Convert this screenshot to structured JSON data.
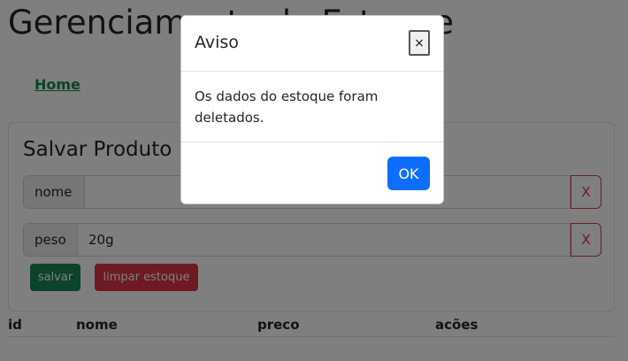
{
  "page": {
    "title": "Gerenciamento de Estoque"
  },
  "nav": {
    "home_label": "Home"
  },
  "form": {
    "title": "Salvar Produto",
    "nome": {
      "label": "nome",
      "value": "",
      "clear_label": "X"
    },
    "peso": {
      "label": "peso",
      "value": "20g",
      "clear_label": "X"
    },
    "save_label": "salvar",
    "clear_stock_label": "limpar estoque"
  },
  "table": {
    "headers": [
      "id",
      "nome",
      "preco",
      "acões"
    ]
  },
  "modal": {
    "title": "Aviso",
    "close_label": "×",
    "message": "Os dados do estoque foram deletados.",
    "ok_label": "OK"
  }
}
